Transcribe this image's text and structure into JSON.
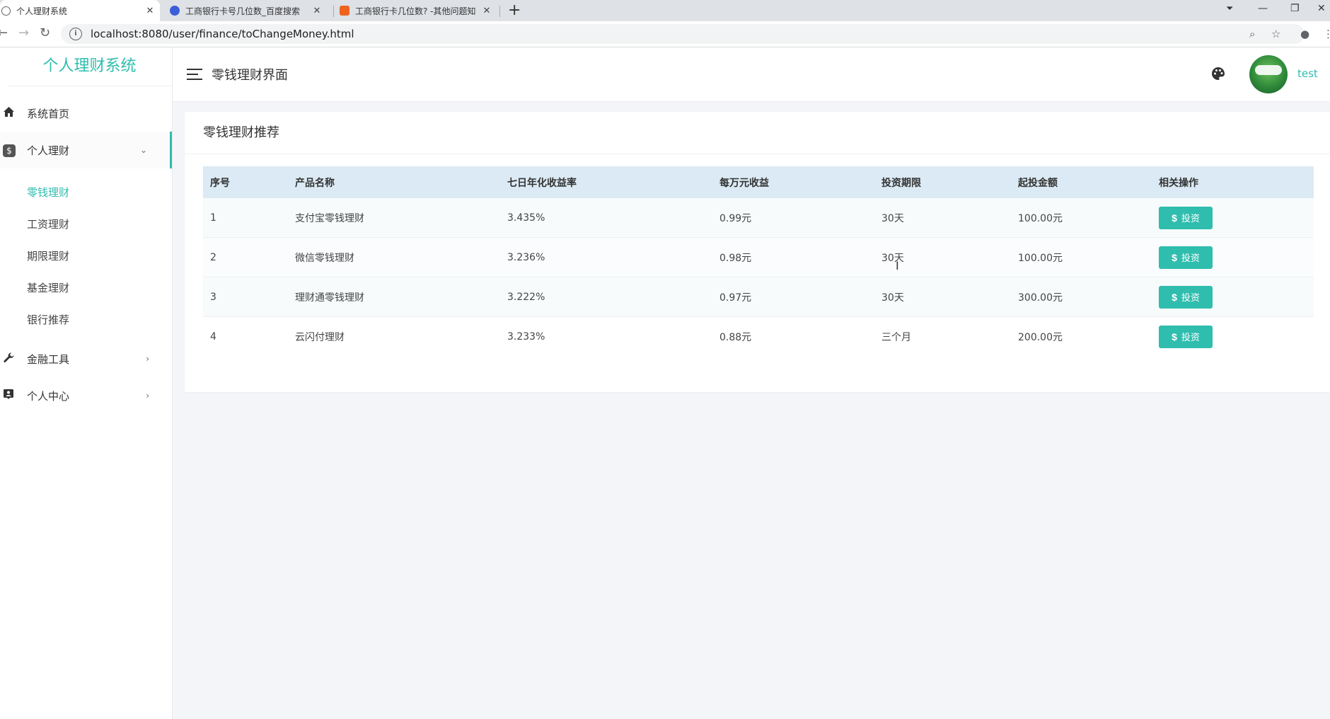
{
  "browser": {
    "tabs": [
      {
        "label": "个人理财系统",
        "active": true
      },
      {
        "label": "工商银行卡号几位数_百度搜索",
        "active": false
      },
      {
        "label": "工商银行卡几位数? -其他问题知",
        "active": false
      }
    ],
    "url": "localhost:8080/user/finance/toChangeMoney.html"
  },
  "sidebar": {
    "logo": "个人理财系统",
    "items": [
      {
        "label": "系统首页",
        "icon": "home-icon"
      },
      {
        "label": "个人理财",
        "icon": "dollar-icon",
        "expanded": true
      },
      {
        "label": "金融工具",
        "icon": "wrench-icon"
      },
      {
        "label": "个人中心",
        "icon": "user-card-icon"
      }
    ],
    "submenu": [
      {
        "label": "零钱理财",
        "active": true
      },
      {
        "label": "工资理财"
      },
      {
        "label": "期限理财"
      },
      {
        "label": "基金理财"
      },
      {
        "label": "银行推荐"
      }
    ]
  },
  "header": {
    "title": "零钱理财界面",
    "username": "test"
  },
  "card": {
    "title": "零钱理财推荐",
    "columns": [
      "序号",
      "产品名称",
      "七日年化收益率",
      "每万元收益",
      "投资期限",
      "起投金额",
      "相关操作"
    ],
    "rows": [
      {
        "id": "1",
        "name": "支付宝零钱理财",
        "rate": "3.435%",
        "per10k": "0.99元",
        "term": "30天",
        "min": "100.00元",
        "action": "投资"
      },
      {
        "id": "2",
        "name": "微信零钱理财",
        "rate": "3.236%",
        "per10k": "0.98元",
        "term": "30天",
        "min": "100.00元",
        "action": "投资"
      },
      {
        "id": "3",
        "name": "理财通零钱理财",
        "rate": "3.222%",
        "per10k": "0.97元",
        "term": "30天",
        "min": "300.00元",
        "action": "投资"
      },
      {
        "id": "4",
        "name": "云闪付理财",
        "rate": "3.233%",
        "per10k": "0.88元",
        "term": "三个月",
        "min": "200.00元",
        "action": "投资"
      }
    ]
  },
  "colors": {
    "accent": "#2fbdae",
    "table_header": "#dbeaf4"
  }
}
